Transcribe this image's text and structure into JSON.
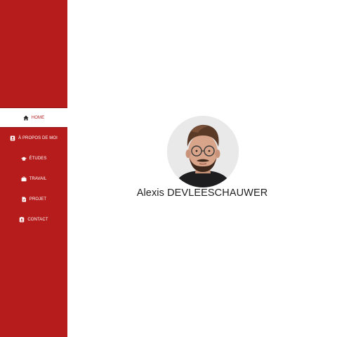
{
  "colors": {
    "sidebar_bg": "#b71c1c",
    "active_bg": "#ffffff",
    "text_light": "#ffffff"
  },
  "sidebar": {
    "items": [
      {
        "label": "HOME",
        "icon": "home-icon",
        "active": true
      },
      {
        "label": "À PROPOS DE MOI",
        "icon": "user-card-icon",
        "active": false
      },
      {
        "label": "ÉTUDES",
        "icon": "graduation-cap-icon",
        "active": false
      },
      {
        "label": "TRAVAIL",
        "icon": "briefcase-icon",
        "active": false
      },
      {
        "label": "PROJET",
        "icon": "file-icon",
        "active": false
      },
      {
        "label": "CONTACT",
        "icon": "contact-card-icon",
        "active": false
      }
    ]
  },
  "profile": {
    "name": "Alexis DEVLEESCHAUWER"
  }
}
